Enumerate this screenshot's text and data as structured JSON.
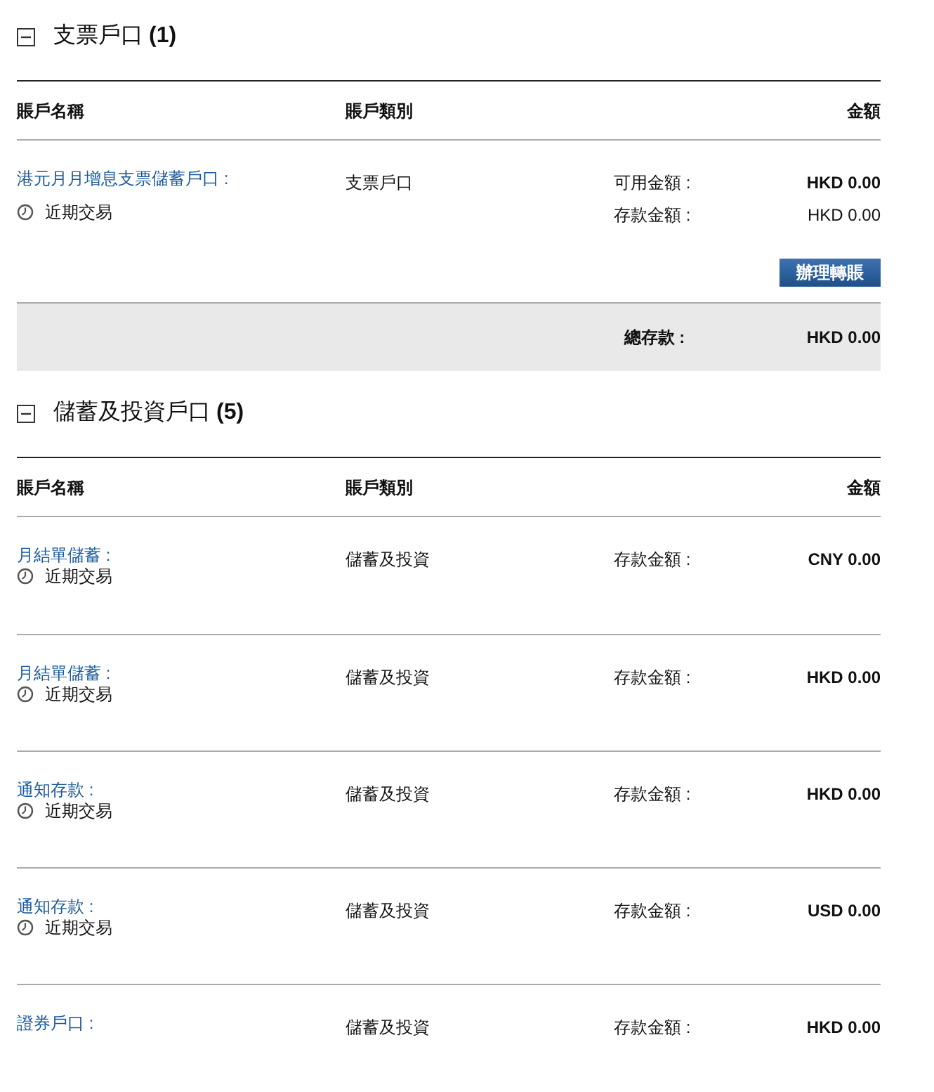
{
  "sections": [
    {
      "title": "支票戶口",
      "count": "(1)",
      "expanded": true,
      "columns": [
        "賬戶名稱",
        "賬戶類別",
        "金額"
      ],
      "rows": [
        {
          "name": "港元月月增息支票儲蓄戶口 :",
          "recent": "近期交易",
          "type": "支票戶口",
          "amounts": [
            {
              "label": "可用金額 :",
              "value": "HKD 0.00",
              "bold": true
            },
            {
              "label": "存款金額 :",
              "value": "HKD 0.00",
              "bold": false
            }
          ],
          "button": "辦理轉賬"
        }
      ],
      "total": {
        "label": "總存款 :",
        "value": "HKD 0.00"
      }
    },
    {
      "title": "儲蓄及投資戶口",
      "count": "(5)",
      "expanded": true,
      "columns": [
        "賬戶名稱",
        "賬戶類別",
        "金額"
      ],
      "rows": [
        {
          "name": "月結單儲蓄 :",
          "recent": "近期交易",
          "type": "儲蓄及投資",
          "amounts": [
            {
              "label": "存款金額 :",
              "value": "CNY 0.00",
              "bold": true
            }
          ]
        },
        {
          "name": "月結單儲蓄 :",
          "recent": "近期交易",
          "type": "儲蓄及投資",
          "amounts": [
            {
              "label": "存款金額 :",
              "value": "HKD 0.00",
              "bold": true
            }
          ]
        },
        {
          "name": "通知存款 :",
          "recent": "近期交易",
          "type": "儲蓄及投資",
          "amounts": [
            {
              "label": "存款金額 :",
              "value": "HKD 0.00",
              "bold": true
            }
          ]
        },
        {
          "name": "通知存款 :",
          "recent": "近期交易",
          "type": "儲蓄及投資",
          "amounts": [
            {
              "label": "存款金額 :",
              "value": "USD 0.00",
              "bold": true
            }
          ]
        },
        {
          "name": "證券戶口 :",
          "type": "儲蓄及投資",
          "amounts": [
            {
              "label": "存款金額 :",
              "value": "HKD 0.00",
              "bold": true
            }
          ]
        }
      ]
    }
  ]
}
